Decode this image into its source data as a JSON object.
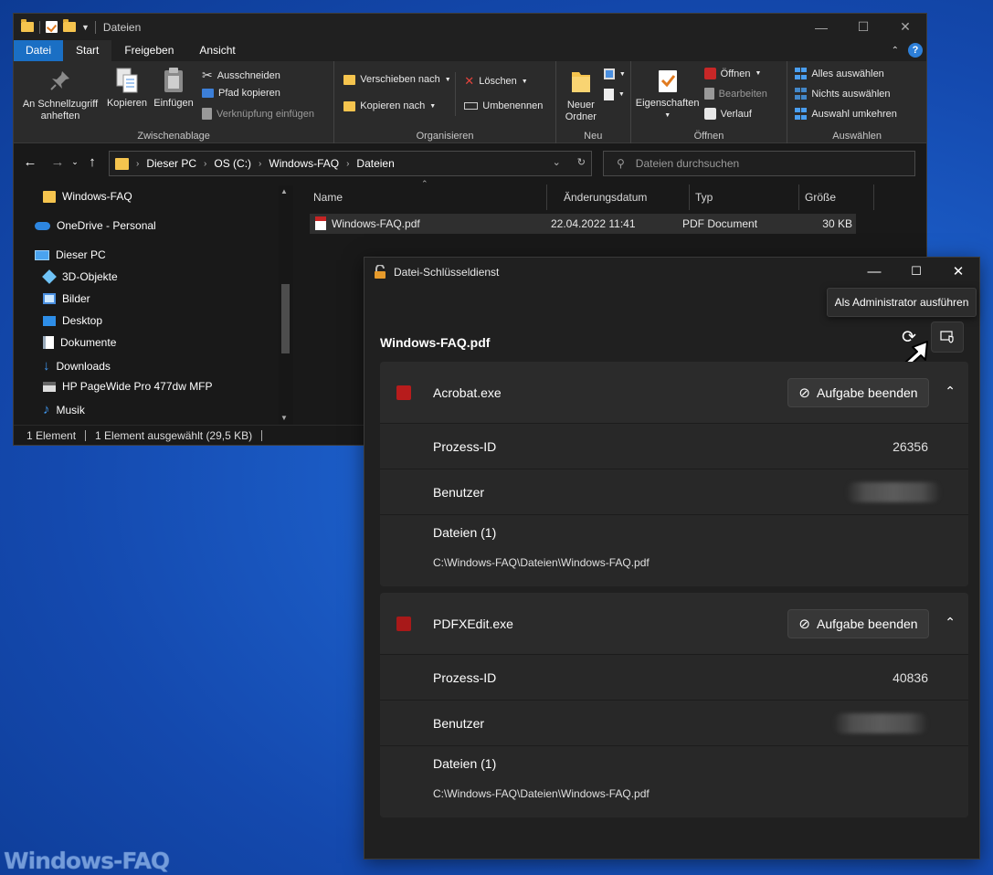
{
  "explorer": {
    "title": "Dateien",
    "tabs": [
      "Datei",
      "Start",
      "Freigeben",
      "Ansicht"
    ],
    "clipboard": {
      "label": "Zwischenablage",
      "pin": "An Schnellzugriff anheften",
      "copy": "Kopieren",
      "paste": "Einfügen",
      "cut": "Ausschneiden",
      "copy_path": "Pfad kopieren",
      "paste_shortcut": "Verknüpfung einfügen"
    },
    "organize": {
      "label": "Organisieren",
      "move_to": "Verschieben nach",
      "copy_to": "Kopieren nach",
      "delete": "Löschen",
      "rename": "Umbenennen"
    },
    "new": {
      "label": "Neu",
      "new_folder": "Neuer Ordner"
    },
    "open": {
      "label": "Öffnen",
      "properties": "Eigenschaften",
      "open": "Öffnen",
      "edit": "Bearbeiten",
      "history": "Verlauf"
    },
    "select": {
      "label": "Auswählen",
      "select_all": "Alles auswählen",
      "select_none": "Nichts auswählen",
      "invert": "Auswahl umkehren"
    },
    "breadcrumbs": [
      "Dieser PC",
      "OS (C:)",
      "Windows-FAQ",
      "Dateien"
    ],
    "search_placeholder": "Dateien durchsuchen",
    "nav_items": [
      "Windows-FAQ",
      "OneDrive - Personal",
      "Dieser PC",
      "3D-Objekte",
      "Bilder",
      "Desktop",
      "Dokumente",
      "Downloads",
      "HP PageWide Pro 477dw MFP",
      "Musik"
    ],
    "columns": [
      "Name",
      "Änderungsdatum",
      "Typ",
      "Größe"
    ],
    "files": [
      {
        "name": "Windows-FAQ.pdf",
        "date": "22.04.2022 11:41",
        "type": "PDF Document",
        "size": "30 KB"
      }
    ],
    "status": {
      "count": "1 Element",
      "selected": "1 Element ausgewählt (29,5 KB)"
    }
  },
  "locksmith": {
    "title": "Datei-Schlüsseldienst",
    "tooltip": "Als Administrator ausführen",
    "filename": "Windows-FAQ.pdf",
    "end_task_label": "Aufgabe beenden",
    "pid_label": "Prozess-ID",
    "user_label": "Benutzer",
    "files_label": "Dateien (1)",
    "processes": [
      {
        "name": "Acrobat.exe",
        "pid": "26356",
        "path": "C:\\Windows-FAQ\\Dateien\\Windows-FAQ.pdf"
      },
      {
        "name": "PDFXEdit.exe",
        "pid": "40836",
        "path": "C:\\Windows-FAQ\\Dateien\\Windows-FAQ.pdf"
      }
    ]
  },
  "watermark": "Windows-FAQ"
}
